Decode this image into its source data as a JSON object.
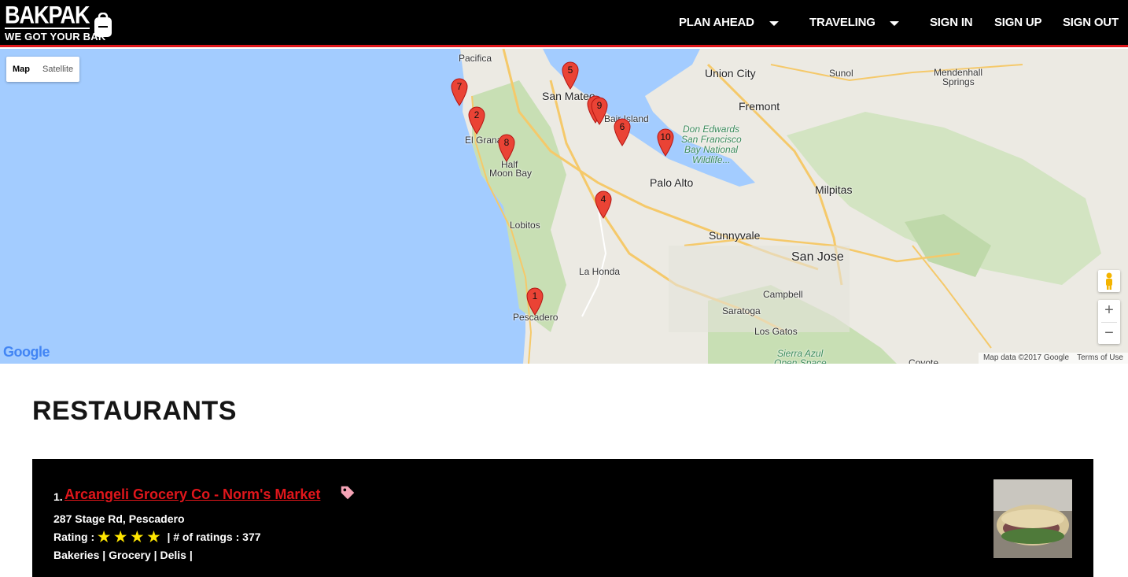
{
  "brand": {
    "name": "BAKPAK",
    "tagline": "WE GOT YOUR BAK"
  },
  "nav": {
    "plan_ahead": "PLAN AHEAD",
    "traveling": "TRAVELING",
    "sign_in": "SIGN IN",
    "sign_up": "SIGN UP",
    "sign_out": "SIGN OUT"
  },
  "map": {
    "type_map": "Map",
    "type_satellite": "Satellite",
    "active_type": "Map",
    "attribution": "Map data ©2017 Google",
    "terms": "Terms of Use",
    "logo": "Google",
    "places": {
      "pacifica": "Pacifica",
      "san_mateo": "San Mateo",
      "union_city": "Union City",
      "fremont": "Fremont",
      "sunol": "Sunol",
      "mendenhall": "Mendenhall",
      "springs": "Springs",
      "bair_island": "Bair Island",
      "el_granada": "El Granada",
      "half": "Half",
      "moon_bay": "Moon Bay",
      "refuge1": "Don Edwards",
      "refuge2": "San Francisco",
      "refuge3": "Bay National",
      "refuge4": "Wildlife...",
      "palo_alto": "Palo Alto",
      "milpitas": "Milpitas",
      "lobitos": "Lobitos",
      "sunnyvale": "Sunnyvale",
      "san_jose": "San Jose",
      "la_honda": "La Honda",
      "campbell": "Campbell",
      "pescadero": "Pescadero",
      "saratoga": "Saratoga",
      "los_gatos": "Los Gatos",
      "sierra_azul": "Sierra Azul",
      "open_space": "Open Space",
      "coyote": "Coyote"
    },
    "markers": [
      "1",
      "2",
      "3",
      "4",
      "5",
      "6",
      "7",
      "8",
      "9",
      "10"
    ]
  },
  "section_title": "RESTAURANTS",
  "restaurants": [
    {
      "number": "1.",
      "name": " Arcangeli Grocery Co - Norm's Market ",
      "address": "287 Stage Rd, Pescadero",
      "rating_label": "Rating : ",
      "rating": 4,
      "ratings_count_text": " | # of ratings : 377",
      "categories": "Bakeries | Grocery | Delis |"
    }
  ],
  "colors": {
    "accent": "#e0161b",
    "header_bg": "#000000",
    "star": "#ffe600",
    "water": "#a3ccff"
  }
}
